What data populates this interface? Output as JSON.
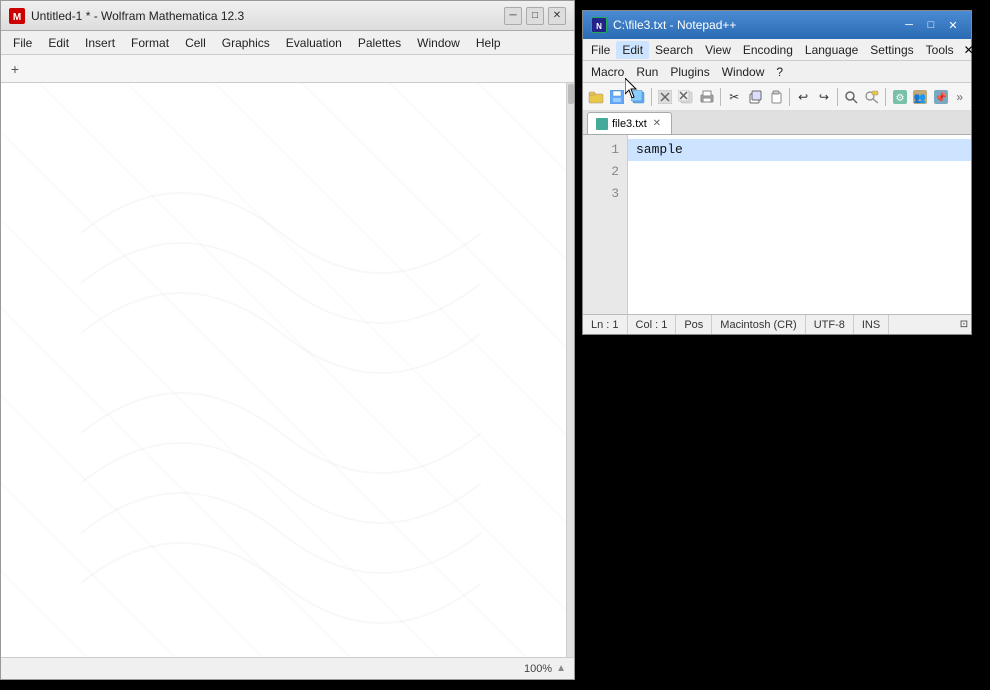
{
  "mathematica": {
    "title": "Untitled-1 * - Wolfram Mathematica 12.3",
    "icon_label": "M",
    "menu_items": [
      "File",
      "Edit",
      "Insert",
      "Format",
      "Cell",
      "Graphics",
      "Evaluation",
      "Palettes",
      "Window",
      "Help"
    ],
    "zoom": "100%",
    "min_btn": "─",
    "max_btn": "□",
    "close_btn": "✕"
  },
  "notepad": {
    "title": "C:\\file3.txt - Notepad++",
    "icon_label": "N",
    "menu_items": [
      "File",
      "Edit",
      "Search",
      "View",
      "Encoding",
      "Language",
      "Settings",
      "Tools"
    ],
    "menu_row2": [
      "Macro",
      "Run",
      "Plugins",
      "Window",
      "?"
    ],
    "tab_name": "file3.txt",
    "close_char": "✕",
    "lines": [
      {
        "num": "1",
        "code": "sample",
        "highlighted": true
      },
      {
        "num": "2",
        "code": "",
        "highlighted": false
      },
      {
        "num": "3",
        "code": "",
        "highlighted": false
      }
    ],
    "status": {
      "ln": "Ln : 1",
      "col": "Col : 1",
      "pos": "Pos",
      "eol": "Macintosh (CR)",
      "encoding": "UTF-8",
      "ins": "INS"
    },
    "min_btn": "─",
    "max_btn": "□",
    "close_btn": "✕",
    "toolbar_buttons": [
      "📂",
      "💾",
      "🖨",
      "✂",
      "📋",
      "↩",
      "↪",
      "🔍",
      "🔎",
      "⚙",
      "👥",
      "📌"
    ],
    "expand_btn": "»"
  }
}
